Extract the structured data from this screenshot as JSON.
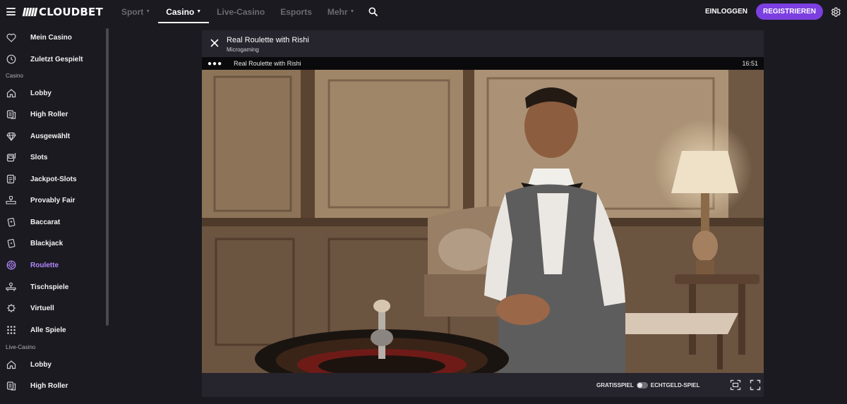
{
  "header": {
    "logo_text": "CLOUDBET",
    "nav": [
      {
        "label": "Sport",
        "chevron": true,
        "active": false
      },
      {
        "label": "Casino",
        "chevron": true,
        "active": true
      },
      {
        "label": "Live-Casino",
        "chevron": false,
        "active": false
      },
      {
        "label": "Esports",
        "chevron": false,
        "active": false
      },
      {
        "label": "Mehr",
        "chevron": true,
        "active": false
      }
    ],
    "login_label": "EINLOGGEN",
    "register_label": "REGISTRIEREN",
    "accent_color": "#7c3fe0"
  },
  "sidebar": {
    "top_items": [
      {
        "label": "Mein Casino",
        "icon": "heart-icon"
      },
      {
        "label": "Zuletzt Gespielt",
        "icon": "clock-icon"
      }
    ],
    "casino_section": "Casino",
    "casino_items": [
      {
        "label": "Lobby",
        "icon": "home-icon"
      },
      {
        "label": "High Roller",
        "icon": "chips-icon"
      },
      {
        "label": "Ausgewählt",
        "icon": "diamond-icon"
      },
      {
        "label": "Slots",
        "icon": "slot-machine-icon"
      },
      {
        "label": "Jackpot-Slots",
        "icon": "jackpot-icon"
      },
      {
        "label": "Provably Fair",
        "icon": "scale-icon"
      },
      {
        "label": "Baccarat",
        "icon": "cards-icon"
      },
      {
        "label": "Blackjack",
        "icon": "cards-icon"
      },
      {
        "label": "Roulette",
        "icon": "roulette-icon",
        "active": true
      },
      {
        "label": "Tischspiele",
        "icon": "table-games-icon"
      },
      {
        "label": "Virtuell",
        "icon": "virtual-icon"
      },
      {
        "label": "Alle Spiele",
        "icon": "grid-icon"
      }
    ],
    "live_section": "Live-Casino",
    "live_items": [
      {
        "label": "Lobby",
        "icon": "home-icon"
      },
      {
        "label": "High Roller",
        "icon": "chips-icon"
      }
    ],
    "active_color": "#b389ff"
  },
  "game": {
    "title": "Real Roulette with Rishi",
    "provider": "Microgaming",
    "bar_dots": "●●●",
    "bar_title": "Real Roulette with Rishi",
    "bar_time": "16:51",
    "footer": {
      "free_label": "GRATISSPIEL",
      "real_label": "ECHTGELD-SPIEL"
    }
  }
}
